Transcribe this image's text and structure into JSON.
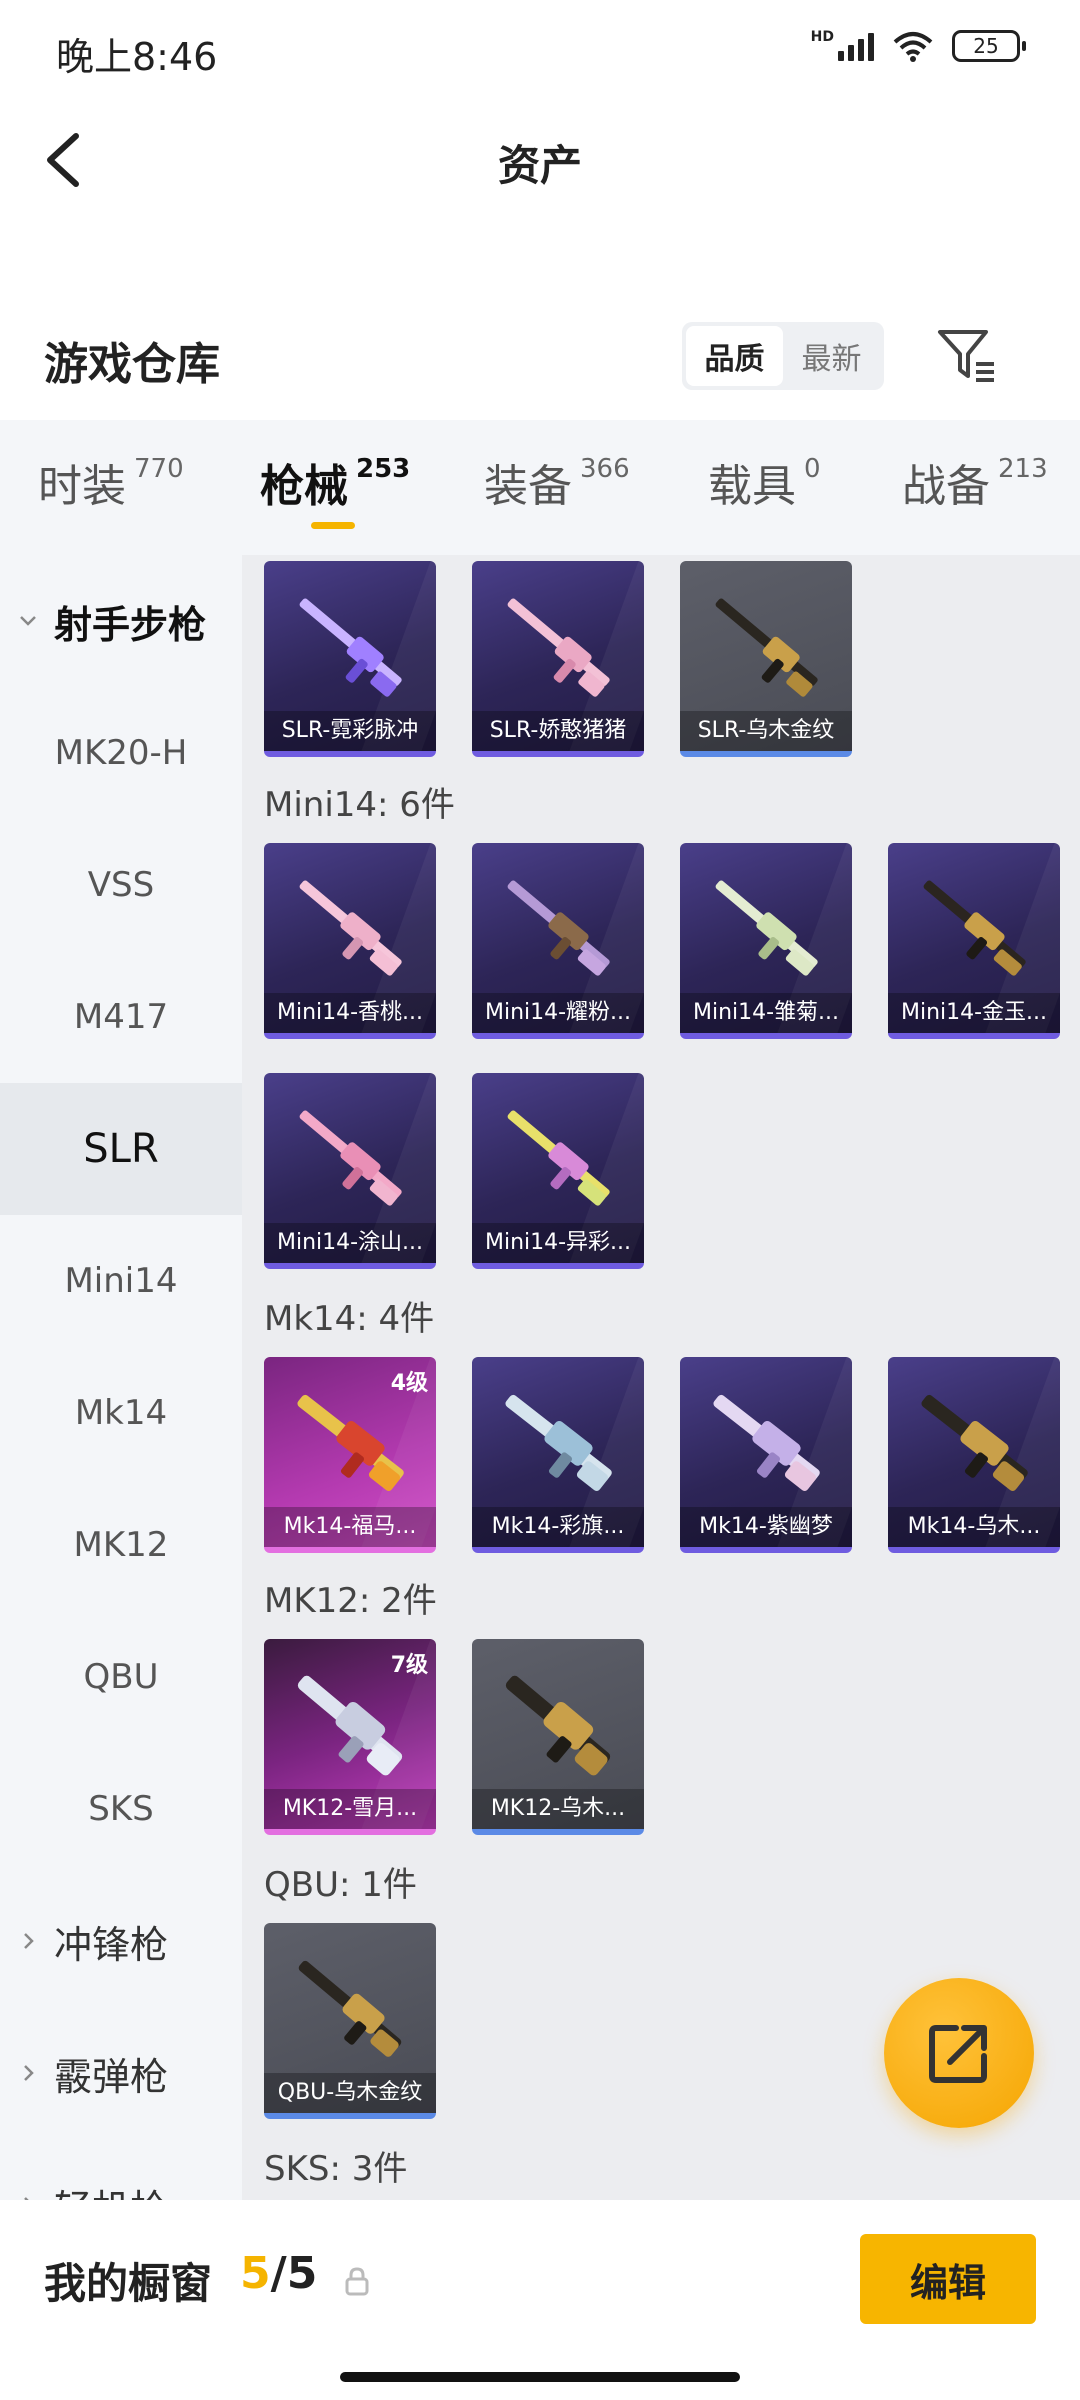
{
  "status_bar": {
    "time": "晚上8:46",
    "battery": "25",
    "network": "HD"
  },
  "header": {
    "title": "资产"
  },
  "repo": {
    "title": "游戏仓库",
    "sort_options": [
      "品质",
      "最新"
    ],
    "sort_active": "品质"
  },
  "tabs": [
    {
      "label": "时装",
      "count": "770"
    },
    {
      "label": "枪械",
      "count": "253",
      "active": true
    },
    {
      "label": "装备",
      "count": "366"
    },
    {
      "label": "载具",
      "count": "0"
    },
    {
      "label": "战备",
      "count": "213"
    }
  ],
  "sidebar": {
    "category": "射手步枪",
    "items": [
      "MK20-H",
      "VSS",
      "M417",
      "SLR",
      "Mini14",
      "Mk14",
      "MK12",
      "QBU",
      "SKS"
    ],
    "active": "SLR",
    "more_categories": [
      "冲锋枪",
      "霰弹枪",
      "轻机枪"
    ]
  },
  "groups": [
    {
      "label": "",
      "items": [
        {
          "name": "SLR-霓彩脉冲",
          "style": "purple"
        },
        {
          "name": "SLR-娇憨猪猪",
          "style": "purple"
        },
        {
          "name": "SLR-乌木金纹",
          "style": "gray"
        }
      ]
    },
    {
      "label": "Mini14: 6件",
      "items": [
        {
          "name": "Mini14-香桃...",
          "style": "purple"
        },
        {
          "name": "Mini14-耀粉...",
          "style": "purple"
        },
        {
          "name": "Mini14-雏菊...",
          "style": "purple"
        },
        {
          "name": "Mini14-金玉...",
          "style": "purple"
        },
        {
          "name": "Mini14-涂山...",
          "style": "purple"
        },
        {
          "name": "Mini14-异彩...",
          "style": "purple"
        }
      ]
    },
    {
      "label": "Mk14: 4件",
      "items": [
        {
          "name": "Mk14-福马...",
          "style": "pink",
          "level": "4级"
        },
        {
          "name": "Mk14-彩旗...",
          "style": "purple"
        },
        {
          "name": "Mk14-紫幽梦",
          "style": "purple"
        },
        {
          "name": "Mk14-乌木...",
          "style": "purple"
        }
      ]
    },
    {
      "label": "MK12: 2件",
      "items": [
        {
          "name": "MK12-雪月...",
          "style": "pink",
          "level": "7级"
        },
        {
          "name": "MK12-乌木...",
          "style": "gray"
        }
      ]
    },
    {
      "label": "QBU: 1件",
      "items": [
        {
          "name": "QBU-乌木金纹",
          "style": "gray"
        }
      ]
    },
    {
      "label": "SKS: 3件",
      "items": []
    }
  ],
  "showcase": {
    "label": "我的橱窗",
    "current": "5",
    "total": "/5"
  },
  "actions": {
    "edit": "编辑"
  },
  "colors": {
    "accent": "#f5b400",
    "purple_card": "#2d2557",
    "pink_card": "#b43ab0",
    "gray_card": "#4a4c55"
  }
}
